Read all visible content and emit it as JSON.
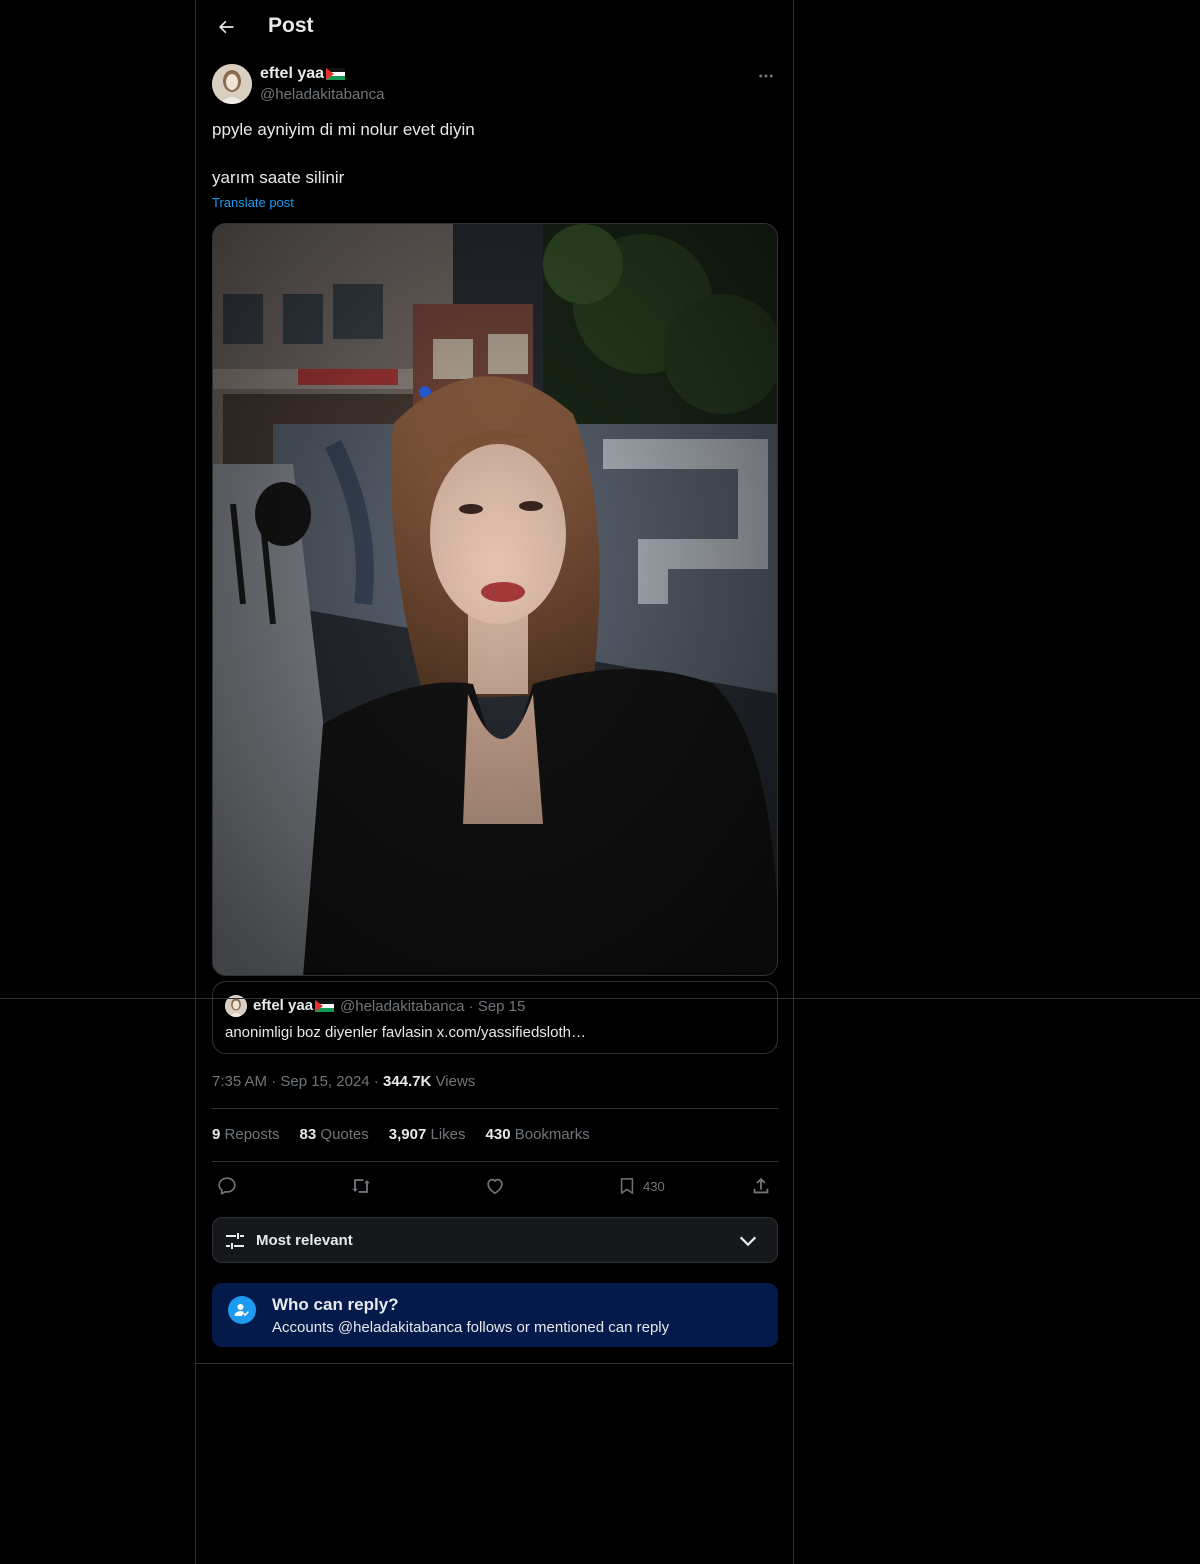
{
  "header": {
    "title": "Post"
  },
  "author": {
    "display_name": "eftel yaa",
    "handle": "@heladakitabanca"
  },
  "post": {
    "line1": "ppyle ayniyim di mi nolur evet diyin",
    "line2": "yarım saate silinir",
    "translate_label": "Translate post"
  },
  "quote": {
    "display_name": "eftel yaa",
    "handle_date": "@heladakitabanca · Sep 15",
    "text": "anonimligi boz diyenler favlasin x.com/yassifiedsloth…"
  },
  "meta": {
    "time": "7:35 AM",
    "date": "Sep 15, 2024",
    "views_count": "344.7K",
    "views_label": "Views"
  },
  "stats": {
    "reposts_count": "9",
    "reposts_label": "Reposts",
    "quotes_count": "83",
    "quotes_label": "Quotes",
    "likes_count": "3,907",
    "likes_label": "Likes",
    "bookmarks_count": "430",
    "bookmarks_label": "Bookmarks"
  },
  "actions": {
    "bookmark_count": "430"
  },
  "sort": {
    "label": "Most relevant"
  },
  "who_can_reply": {
    "title": "Who can reply?",
    "subtitle": "Accounts @heladakitabanca follows or mentioned can reply"
  },
  "colors": {
    "accent": "#1d9bf0",
    "background": "#000000",
    "muted": "#71767b",
    "border": "#2f3336"
  }
}
